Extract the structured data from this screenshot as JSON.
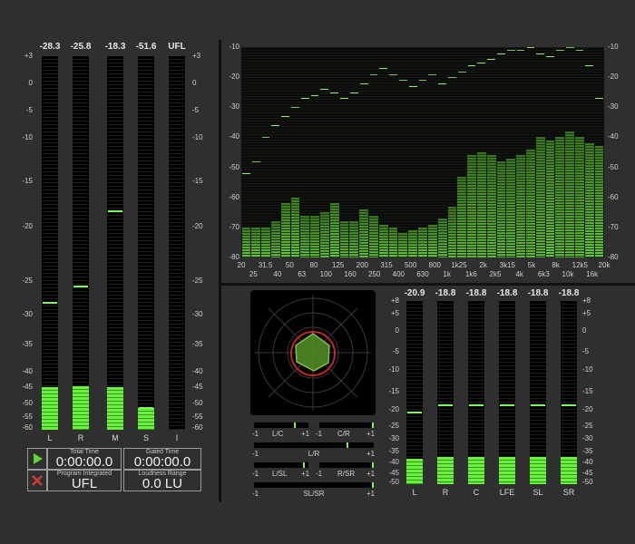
{
  "left_meters": {
    "scale_left": [
      "+3",
      "0",
      "-5",
      "-10",
      "-15",
      "-20",
      "-25",
      "-30",
      "-35",
      "-40",
      "-45",
      "-50",
      "-55",
      "-60"
    ],
    "scale_right": [
      "+3",
      "0",
      "-5",
      "-10",
      "-15",
      "-20",
      "-25",
      "-30",
      "-35",
      "-40",
      "-45",
      "-50",
      "-55",
      "-60"
    ],
    "channels": [
      {
        "label": "L",
        "value": "-28.3",
        "level_db": -28.3,
        "fill_db": -45
      },
      {
        "label": "R",
        "value": "-25.8",
        "level_db": -25.8,
        "fill_db": -44.8
      },
      {
        "label": "M",
        "value": "-18.3",
        "level_db": -18.3,
        "fill_db": -45
      },
      {
        "label": "S",
        "value": "-51.6",
        "level_db": -51.6,
        "fill_db": -51.6
      },
      {
        "label": "I",
        "value": "UFL",
        "level_db": null,
        "fill_db": null
      }
    ]
  },
  "readouts": {
    "total_time_label": "Total Time",
    "total_time": "0:00:00.0",
    "gated_time_label": "Gated Time",
    "gated_time": "0:00:00.0",
    "program_label": "Program Integrated",
    "program_value": "UFL",
    "range_label": "Loudness Range",
    "range_value": "0.0 LU"
  },
  "spectrum": {
    "y_ticks": [
      "-10",
      "-20",
      "-30",
      "-40",
      "-50",
      "-60",
      "-70",
      "-80"
    ],
    "x_top": [
      "20",
      "31.5",
      "50",
      "80",
      "125",
      "200",
      "315",
      "500",
      "800",
      "1k25",
      "2k",
      "3k15",
      "5k",
      "8k",
      "12k5",
      "20k"
    ],
    "x_bottom": [
      "25",
      "40",
      "63",
      "100",
      "160",
      "250",
      "400",
      "630",
      "1k",
      "1k6",
      "2k5",
      "4k",
      "6k3",
      "10k",
      "16k"
    ],
    "bands": [
      -70,
      -70,
      -70,
      -68,
      -62,
      -60,
      -66,
      -66,
      -65,
      -62,
      -68,
      -68,
      -64,
      -66,
      -69,
      -70,
      -72,
      -71,
      -70,
      -69,
      -67,
      -63,
      -53,
      -46,
      -45,
      -46,
      -48,
      -47,
      -46,
      -44,
      -40,
      -41,
      -40,
      -38,
      -40,
      -42,
      -43
    ],
    "peaks": [
      -52,
      -48,
      -40,
      -36,
      -33,
      -30,
      -27,
      -26,
      -24,
      -25,
      -27,
      -25,
      -22,
      -19,
      -17,
      -19,
      -21,
      -23,
      -21,
      -19,
      -22,
      -20,
      -18,
      -16,
      -15,
      -14,
      -12,
      -11,
      -11,
      -10,
      -12,
      -13,
      -11,
      -10,
      -11,
      -16,
      -27
    ]
  },
  "surround_meters": {
    "scale": [
      "+8",
      "+5",
      "0",
      "-5",
      "-10",
      "-15",
      "-20",
      "-25",
      "-30",
      "-35",
      "-40",
      "-45",
      "-50"
    ],
    "channels": [
      {
        "label": "L",
        "value": "-20.9",
        "level_db": -20.9,
        "fill_db": -38.5
      },
      {
        "label": "R",
        "value": "-18.8",
        "level_db": -18.8,
        "fill_db": -37.5
      },
      {
        "label": "C",
        "value": "-18.8",
        "level_db": -18.8,
        "fill_db": -37.5
      },
      {
        "label": "LFE",
        "value": "-18.8",
        "level_db": -18.8,
        "fill_db": -37.5
      },
      {
        "label": "SL",
        "value": "-18.8",
        "level_db": -18.8,
        "fill_db": -37.5
      },
      {
        "label": "SR",
        "value": "-18.8",
        "level_db": -18.8,
        "fill_db": -37.5
      }
    ]
  },
  "correlation": {
    "bars": [
      {
        "left": "-1",
        "label": "L/C",
        "right": "+1",
        "left2": "-1",
        "label2": "C/R",
        "right2": "+1"
      },
      {
        "left": "-1",
        "label": "L/R",
        "right": "+1"
      },
      {
        "left": "-1",
        "label": "L/SL",
        "right": "+1",
        "left2": "-1",
        "label2": "R/SR",
        "right2": "+1"
      },
      {
        "left": "-1",
        "label": "SL/SR",
        "right": "+1"
      }
    ]
  },
  "colors": {
    "meter_green": "#6cf03f",
    "peak_green": "#77ff55",
    "background": "#2f2f2f"
  }
}
